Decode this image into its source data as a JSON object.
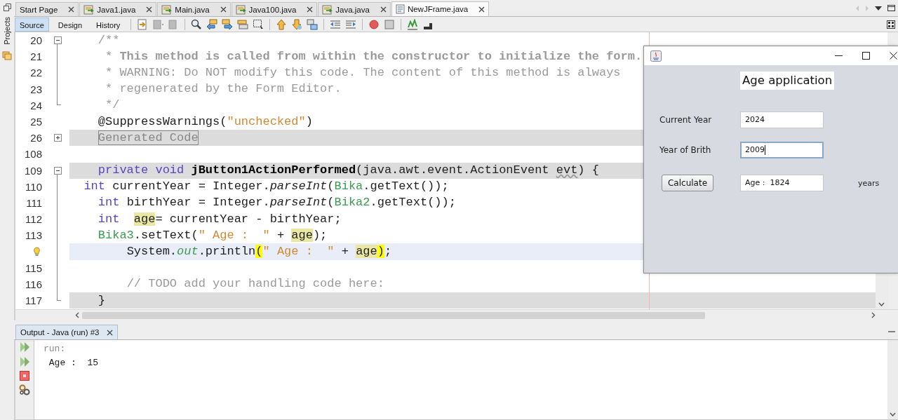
{
  "sidebar": {
    "label": "Projects"
  },
  "tabs": [
    {
      "label": "Start Page",
      "kind": "page",
      "selected": false
    },
    {
      "label": "Java1.java",
      "kind": "java",
      "selected": false
    },
    {
      "label": "Main.java",
      "kind": "java",
      "selected": false
    },
    {
      "label": "Java100.java",
      "kind": "java",
      "selected": false
    },
    {
      "label": "Java.java",
      "kind": "java",
      "selected": false
    },
    {
      "label": "NewJFrame.java",
      "kind": "form",
      "selected": true
    }
  ],
  "editor_modes": [
    {
      "label": "Source",
      "selected": true
    },
    {
      "label": "Design",
      "selected": false
    },
    {
      "label": "History",
      "selected": false
    }
  ],
  "code": {
    "lines": [
      {
        "number": "20",
        "expanded": true,
        "highlighted": false,
        "current": false,
        "hint": false,
        "tokens": [
          {
            "kind": "comment",
            "text": "    /**"
          }
        ],
        "children": [
          {
            "number": "21",
            "highlighted": false,
            "current": false,
            "hint": false,
            "tokens": [
              {
                "kind": "comment",
                "text": "     *"
              },
              {
                "kind": "comment-bold",
                "text": " This method is called from within the constructor to initialize the form."
              }
            ]
          },
          {
            "number": "22",
            "highlighted": false,
            "current": false,
            "hint": false,
            "tokens": [
              {
                "kind": "comment",
                "text": "     * WARNING: Do NOT modify this code. The content of this method is always"
              }
            ]
          },
          {
            "number": "23",
            "highlighted": false,
            "current": false,
            "hint": false,
            "tokens": [
              {
                "kind": "comment",
                "text": "     * regenerated by the Form Editor."
              }
            ]
          },
          {
            "number": "24",
            "highlighted": false,
            "current": false,
            "hint": false,
            "tokens": [
              {
                "kind": "comment",
                "text": "     */"
              }
            ]
          }
        ]
      },
      {
        "number": "25",
        "highlighted": false,
        "current": false,
        "hint": false,
        "tokens": [
          {
            "kind": "plain",
            "text": "    @SuppressWarnings("
          },
          {
            "kind": "string",
            "text": "\"unchecked\""
          },
          {
            "kind": "plain",
            "text": ")"
          }
        ]
      },
      {
        "number": "26",
        "expanded": false,
        "highlighted": true,
        "current": false,
        "hint": false,
        "tokens": [
          {
            "kind": "folded",
            "text": "    Generated Code"
          }
        ]
      },
      {
        "number": "108",
        "highlighted": false,
        "current": false,
        "hint": false
      },
      {
        "number": "109",
        "expanded": true,
        "highlighted": true,
        "current": false,
        "hint": false,
        "tokens": [
          {
            "kind": "keyword",
            "text": "    private"
          },
          {
            "kind": "keyword",
            "text": " void"
          },
          {
            "kind": "method-bold",
            "text": " jButton1ActionPerformed"
          },
          {
            "kind": "plain",
            "text": "(java.awt.event.ActionEvent"
          },
          {
            "kind": "unused",
            "text": " evt"
          },
          {
            "kind": "plain",
            "text": ") {"
          }
        ],
        "children": [
          {
            "number": "110",
            "highlighted": false,
            "current": false,
            "hint": false,
            "tokens": [
              {
                "kind": "keyword",
                "text": "  int"
              },
              {
                "kind": "plain",
                "text": " currentYear = Integer."
              },
              {
                "kind": "static",
                "text": "parseInt"
              },
              {
                "kind": "plain",
                "text": "("
              },
              {
                "kind": "field",
                "text": "Bika"
              },
              {
                "kind": "plain",
                "text": ".getText());"
              }
            ]
          },
          {
            "number": "111",
            "highlighted": false,
            "current": false,
            "hint": false,
            "tokens": [
              {
                "kind": "keyword",
                "text": "    int"
              },
              {
                "kind": "plain",
                "text": " birthYear = Integer."
              },
              {
                "kind": "static",
                "text": "parseInt"
              },
              {
                "kind": "plain",
                "text": "("
              },
              {
                "kind": "field",
                "text": "Bika2"
              },
              {
                "kind": "plain",
                "text": ".getText());"
              }
            ]
          },
          {
            "number": "112",
            "highlighted": false,
            "current": false,
            "hint": false,
            "tokens": [
              {
                "kind": "keyword",
                "text": "    int"
              },
              {
                "kind": "occurrence",
                "text": "  age"
              },
              {
                "kind": "plain",
                "text": "= currentYear - birthYear;"
              }
            ]
          },
          {
            "number": "113",
            "highlighted": false,
            "current": false,
            "hint": false,
            "tokens": [
              {
                "kind": "field",
                "text": "    Bika3"
              },
              {
                "kind": "plain",
                "text": ".setText("
              },
              {
                "kind": "string",
                "text": "\" Age :  \""
              },
              {
                "kind": "plain",
                "text": " +"
              },
              {
                "kind": "occurrence",
                "text": " age"
              },
              {
                "kind": "plain",
                "text": ");"
              }
            ]
          },
          {
            "highlighted": false,
            "current": true,
            "hint": true,
            "tokens": [
              {
                "kind": "plain",
                "text": "        System."
              },
              {
                "kind": "static-field",
                "text": "out"
              },
              {
                "kind": "plain",
                "text": ".println"
              },
              {
                "kind": "brace",
                "text": "("
              },
              {
                "kind": "string",
                "text": "\" Age :  \""
              },
              {
                "kind": "plain",
                "text": " +"
              },
              {
                "kind": "occurrence",
                "text": " age"
              },
              {
                "kind": "brace",
                "text": ")"
              },
              {
                "kind": "plain",
                "text": ";"
              }
            ]
          },
          {
            "number": "115",
            "highlighted": false,
            "current": false,
            "hint": false
          },
          {
            "number": "116",
            "highlighted": false,
            "current": false,
            "hint": false,
            "tokens": [
              {
                "kind": "comment",
                "text": "        // TODO add your handling code here:"
              }
            ]
          },
          {
            "number": "117",
            "highlighted": true,
            "current": false,
            "hint": false,
            "tokens": [
              {
                "kind": "plain",
                "text": "    }"
              }
            ]
          }
        ]
      }
    ]
  },
  "output": {
    "title": "Output - Java (run) #3",
    "lines": [
      {
        "kind": "system",
        "text": "run:"
      },
      {
        "kind": "program",
        "text": " Age :  15"
      }
    ]
  },
  "app_window": {
    "heading": "Age application",
    "fields": [
      {
        "label": "Current Year",
        "value": "2024",
        "focused": false
      },
      {
        "label": "Year of Brith",
        "value": "2009",
        "focused": true
      }
    ],
    "button": "Calculate",
    "result": {
      "value": "Age :  1824",
      "unit": "years"
    }
  }
}
